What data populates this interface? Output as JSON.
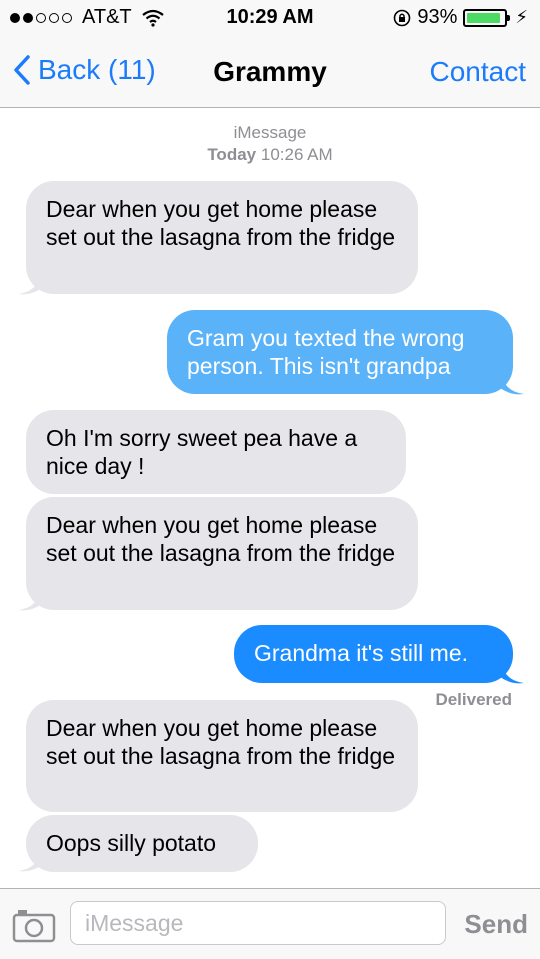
{
  "status_bar": {
    "carrier": "AT&T",
    "time": "10:29 AM",
    "battery": "93%",
    "battery_level": 0.93,
    "signal_bars_filled": 2,
    "signal_bars_total": 5
  },
  "nav": {
    "back_label": "Back (11)",
    "title": "Grammy",
    "contact_label": "Contact"
  },
  "conversation_meta": {
    "service": "iMessage",
    "day": "Today",
    "time": "10:26 AM"
  },
  "messages": [
    {
      "direction": "in",
      "text": "Dear when you get home please set out the lasagna from the fridge"
    },
    {
      "direction": "out",
      "text": "Gram you texted the wrong person. This isn't grandpa"
    },
    {
      "direction": "in",
      "text": "Oh I'm sorry sweet pea have a nice day !"
    },
    {
      "direction": "in",
      "text": "Dear when you get home please set out the lasagna from the fridge"
    },
    {
      "direction": "out",
      "text": "Grandma it's still me."
    },
    {
      "direction": "in",
      "text": "Dear when you get home please set out the lasagna from the fridge"
    },
    {
      "direction": "in",
      "text": "Oops silly potato"
    }
  ],
  "delivered_label": "Delivered",
  "input_bar": {
    "placeholder": "iMessage",
    "send_label": "Send"
  },
  "colors": {
    "accent_blue": "#1a7cfb",
    "outgoing_bubble": "#1a8cff",
    "incoming_bubble": "#e5e5ea",
    "battery_green": "#4cd964"
  }
}
